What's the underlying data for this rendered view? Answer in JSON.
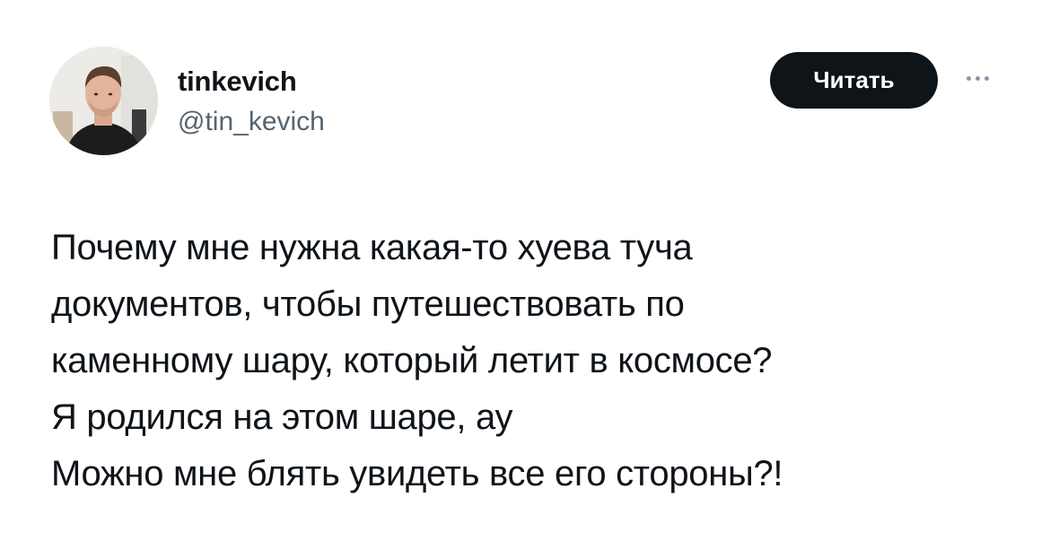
{
  "author": {
    "display_name": "tinkevich",
    "handle": "@tin_kevich",
    "avatar_icon": "profile-photo"
  },
  "actions": {
    "follow_label": "Читать",
    "more_icon": "more-dots-icon"
  },
  "tweet": {
    "lines": [
      "Почему мне нужна какая-то хуева туча",
      "документов, чтобы путешествовать по",
      "каменному шару, который летит в космосе?",
      "Я родился на этом шаре, ау",
      "Можно мне блять увидеть все его стороны?!"
    ]
  },
  "colors": {
    "text_primary": "#0f1419",
    "text_secondary": "#536471",
    "button_bg": "#0f1419",
    "button_text": "#ffffff",
    "background": "#ffffff"
  }
}
